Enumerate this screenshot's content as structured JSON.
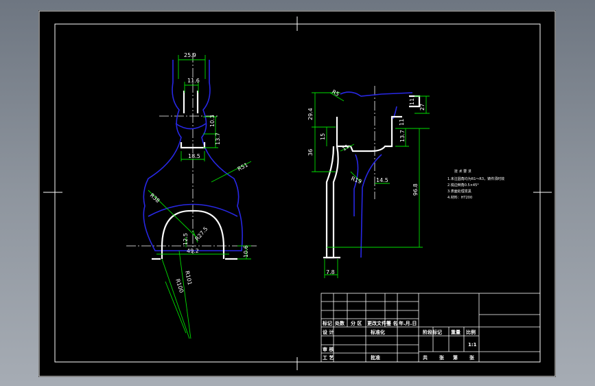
{
  "colors": {
    "background": "#000000",
    "frame": "#ffffff",
    "part_outline": "#2828e6",
    "dimension": "#00e000",
    "centerline": "#ffffff"
  },
  "left_view": {
    "dims": {
      "top_width": "25.9",
      "neck_width": "11.6",
      "neck_height": "10.3",
      "slot_height": "13.7",
      "slot_width": "18.5",
      "radius_outer": "R51",
      "radius_left": "R38",
      "inner_radius": "R27.5",
      "center_height": "12.5",
      "bottom_width": "49.2",
      "bottom_height": "10.6",
      "diag_1": "R100",
      "diag_2": "R101"
    }
  },
  "right_view": {
    "dims": {
      "top_radius": "R5",
      "height_a": "29.4",
      "height_b": "15",
      "height_c": "36",
      "top_right_w": "11",
      "top_right_h": "27",
      "step_h": "11",
      "step_h2": "13.7",
      "bend_dim": "11",
      "radius_bend": "R19",
      "horiz": "14.5",
      "total_h": "96.8",
      "bottom_w": "7.8"
    }
  },
  "notes": [
    "技 术 要 求",
    "1.未注圆角均为R1～R3，铸件须时效",
    "2.锐边倒角0.5×45°",
    "3.表面处理发黑",
    "4.材料：HT200"
  ],
  "title_block": {
    "rev_headers": [
      "标记",
      "处数",
      "分 区",
      "更改文件号",
      "签 名",
      "年.月.日"
    ],
    "left_rows": [
      "设 计",
      "审 核",
      "工 艺"
    ],
    "std": "标准化",
    "approve": "批准",
    "stage": "阶段标记",
    "weight": "重量",
    "scale": "比例",
    "scale_value": "1:1",
    "sheets": "共",
    "sheet_of": "张",
    "sheet_no": "第",
    "sheet_unit": "张"
  }
}
